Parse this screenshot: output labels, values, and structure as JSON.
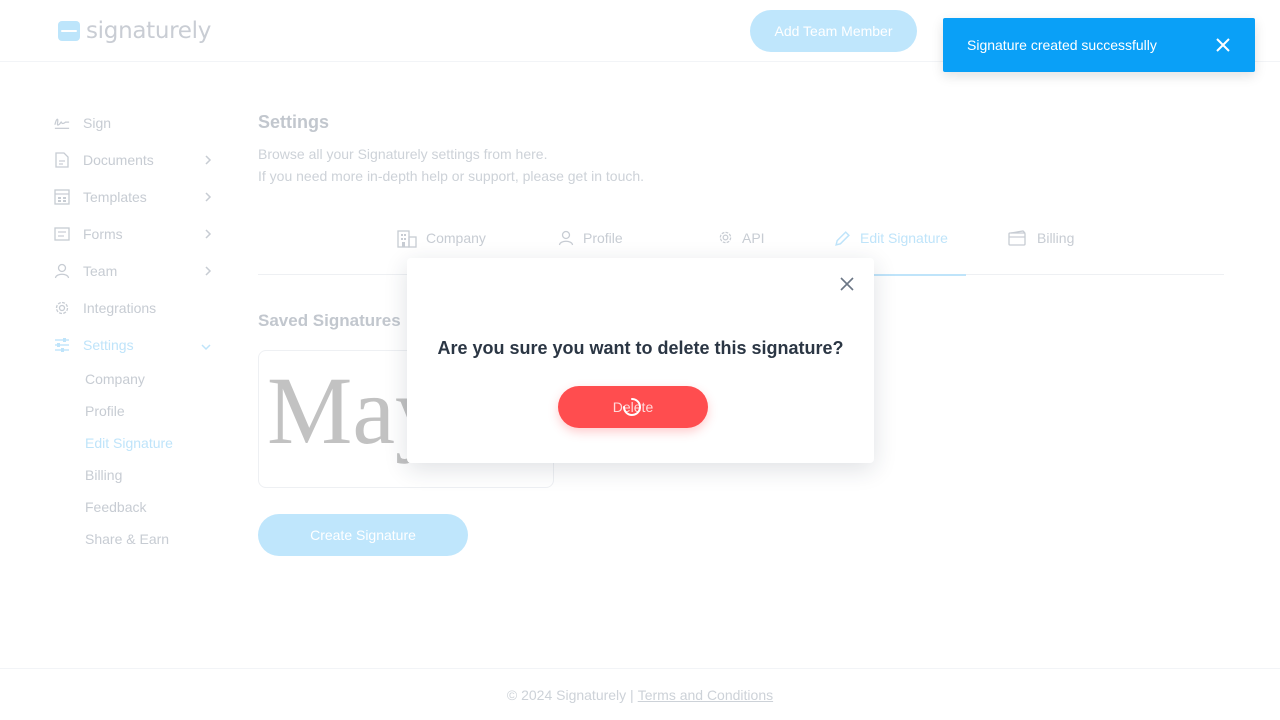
{
  "header": {
    "logo_text": "signaturely",
    "add_team_member_label": "Add Team Member"
  },
  "sidebar": {
    "items": [
      {
        "label": "Sign",
        "icon": "signature-icon"
      },
      {
        "label": "Documents",
        "icon": "document-icon",
        "has_chevron": true
      },
      {
        "label": "Templates",
        "icon": "template-icon",
        "has_chevron": true
      },
      {
        "label": "Forms",
        "icon": "form-icon",
        "has_chevron": true
      },
      {
        "label": "Team",
        "icon": "user-icon",
        "has_chevron": true
      },
      {
        "label": "Integrations",
        "icon": "gear-icon"
      },
      {
        "label": "Settings",
        "icon": "sliders-icon",
        "expanded": true,
        "active": true
      }
    ],
    "settings_subitems": [
      {
        "label": "Company"
      },
      {
        "label": "Profile"
      },
      {
        "label": "Edit Signature",
        "active": true
      },
      {
        "label": "Billing"
      },
      {
        "label": "Feedback"
      },
      {
        "label": "Share & Earn"
      }
    ]
  },
  "main": {
    "title": "Settings",
    "desc_line1": "Browse all your Signaturely settings from here.",
    "desc_line2": "If you need more in-depth help or support, please get in touch.",
    "tabs": [
      {
        "label": "Company",
        "icon": "building-icon"
      },
      {
        "label": "Profile",
        "icon": "user-icon"
      },
      {
        "label": "API",
        "icon": "gear-icon"
      },
      {
        "label": "Edit Signature",
        "icon": "pencil-icon",
        "active": true
      },
      {
        "label": "Billing",
        "icon": "wallet-icon"
      }
    ],
    "saved_signatures_title": "Saved Signatures",
    "signature_preview": "Maya",
    "create_signature_label": "Create Signature"
  },
  "footer": {
    "copyright": "© 2024 Signaturely |",
    "terms_label": "Terms and Conditions"
  },
  "modal": {
    "title": "Are you sure you want to delete this signature?",
    "delete_label": "Delete",
    "loading": true
  },
  "toast": {
    "message": "Signature created successfully"
  },
  "colors": {
    "accent": "#0aa0f7",
    "danger": "#ff4d4f",
    "faded_accent": "#bfe6fc"
  }
}
